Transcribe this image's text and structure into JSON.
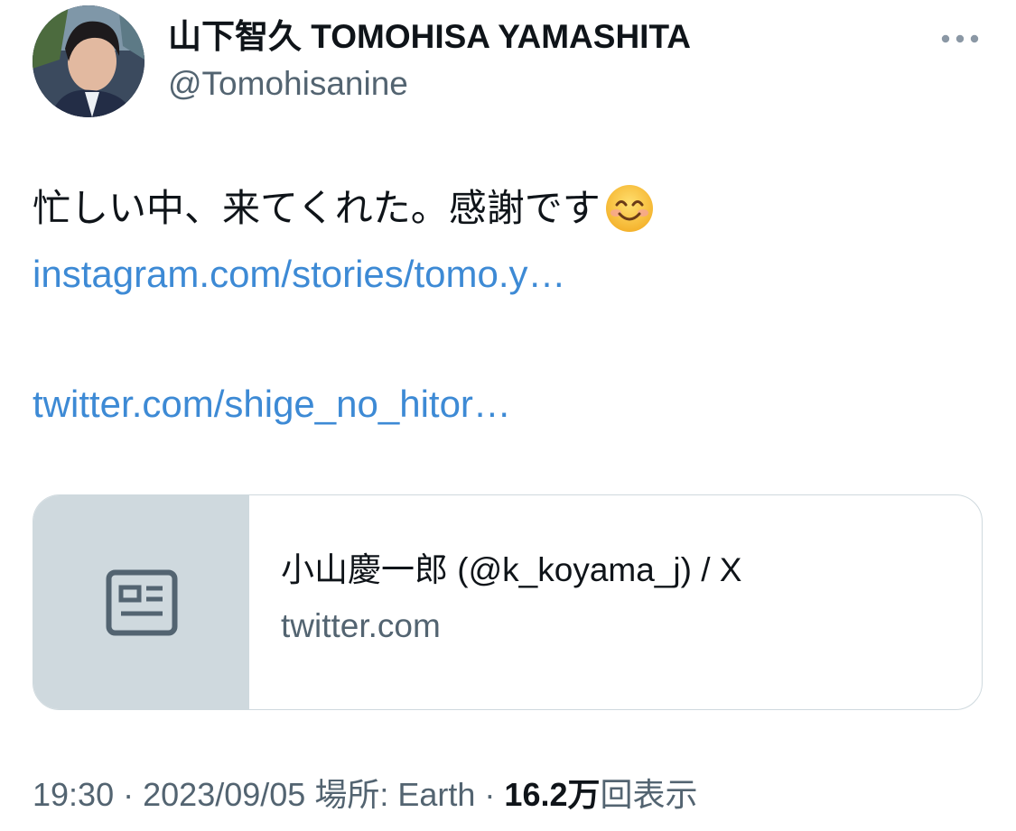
{
  "author": {
    "display_name": "山下智久 TOMOHISA YAMASHITA",
    "handle": "@Tomohisanine",
    "avatar_icon": "profile-photo"
  },
  "header": {
    "more_icon": "more-horizontal-icon"
  },
  "tweet": {
    "text": "忙しい中、来てくれた。感謝です",
    "emoji": "smiling-face-icon",
    "links": [
      "instagram.com/stories/tomo.y…",
      "twitter.com/shige_no_hitor…"
    ]
  },
  "card": {
    "thumbnail_icon": "article-icon",
    "title": "小山慶一郎 (@k_koyama_j) / X",
    "domain": "twitter.com"
  },
  "meta": {
    "time": "19:30",
    "separator": "·",
    "date": "2023/09/05",
    "location": "場所: Earth",
    "views_count": "16.2万",
    "views_label": "回表示"
  },
  "colors": {
    "text": "#0f1419",
    "secondary": "#536471",
    "link": "#3d8ad5",
    "border": "#cfd9de"
  }
}
